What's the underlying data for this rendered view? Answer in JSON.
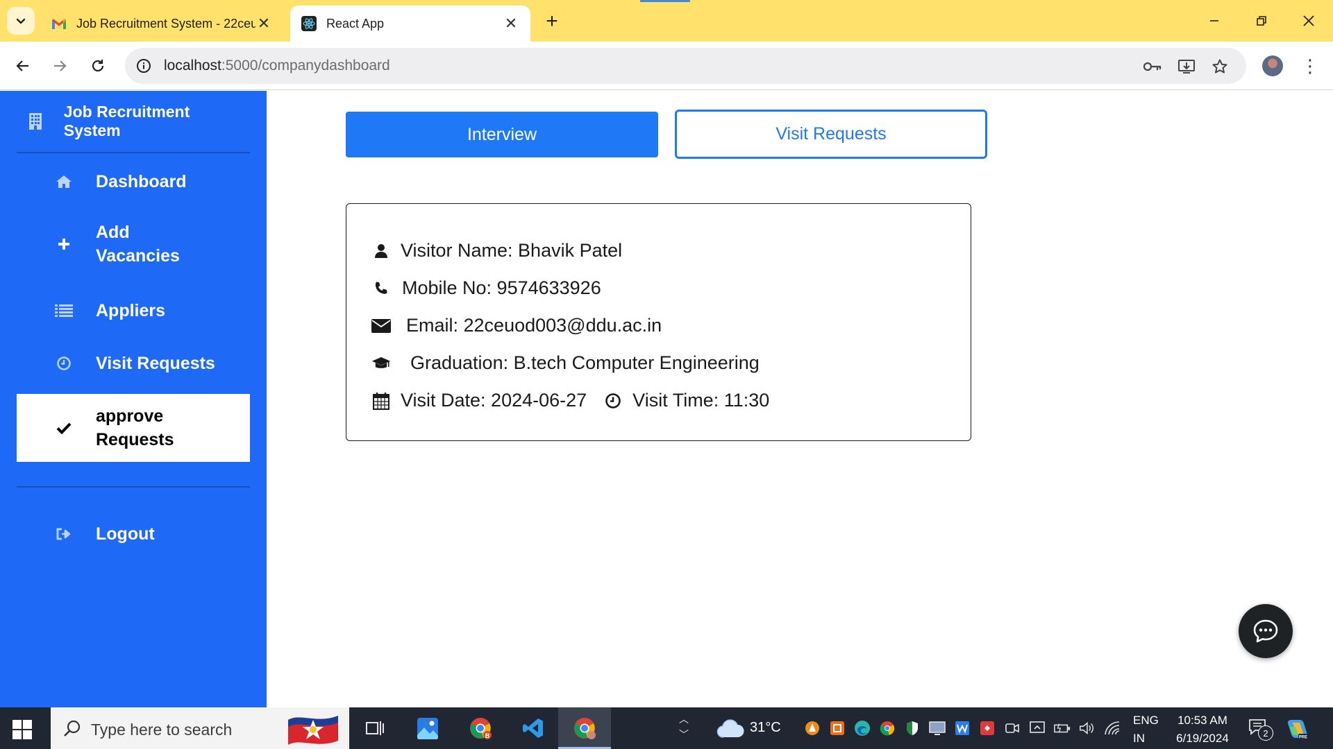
{
  "browser": {
    "tabs": [
      {
        "title": "Job Recruitment System - 22ceu",
        "favicon": "gmail-icon",
        "active": false
      },
      {
        "title": "React App",
        "favicon": "react-icon",
        "active": true
      }
    ],
    "url_host": "localhost",
    "url_path": ":5000/companydashboard"
  },
  "sidebar": {
    "brand": "Job Recruitment System",
    "items": [
      {
        "label": "Dashboard",
        "icon": "home-icon"
      },
      {
        "label": "Add Vacancies",
        "line1": "Add",
        "line2": "Vacancies",
        "icon": "plus-icon"
      },
      {
        "label": "Appliers",
        "icon": "list-icon"
      },
      {
        "label": "Visit Requests",
        "icon": "clock-icon"
      },
      {
        "label": "approve Requests",
        "line1": "approve",
        "line2": "Requests",
        "icon": "check-icon",
        "active": true
      }
    ],
    "logout": "Logout"
  },
  "main": {
    "tab_interview": "Interview",
    "tab_visit_requests": "Visit Requests",
    "visitor": {
      "name_line": "Visitor Name: Bhavik Patel",
      "mobile_line": "Mobile No: 9574633926",
      "email_line": "Email: 22ceuod003@ddu.ac.in",
      "graduation_line": "Graduation: B.tech Computer Engineering",
      "date_line": "Visit Date: 2024-06-27",
      "time_line": "Visit Time: 11:30"
    }
  },
  "taskbar": {
    "search_placeholder": "Type here to search",
    "temperature": "31°C",
    "lang_top": "ENG",
    "lang_bottom": "IN",
    "time": "10:53 AM",
    "date": "6/19/2024",
    "notification_count": "2"
  },
  "colors": {
    "sidebar": "#1e6af7",
    "primary": "#1f78f5",
    "tabstrip": "#ffe16b",
    "taskbar": "#202733"
  }
}
